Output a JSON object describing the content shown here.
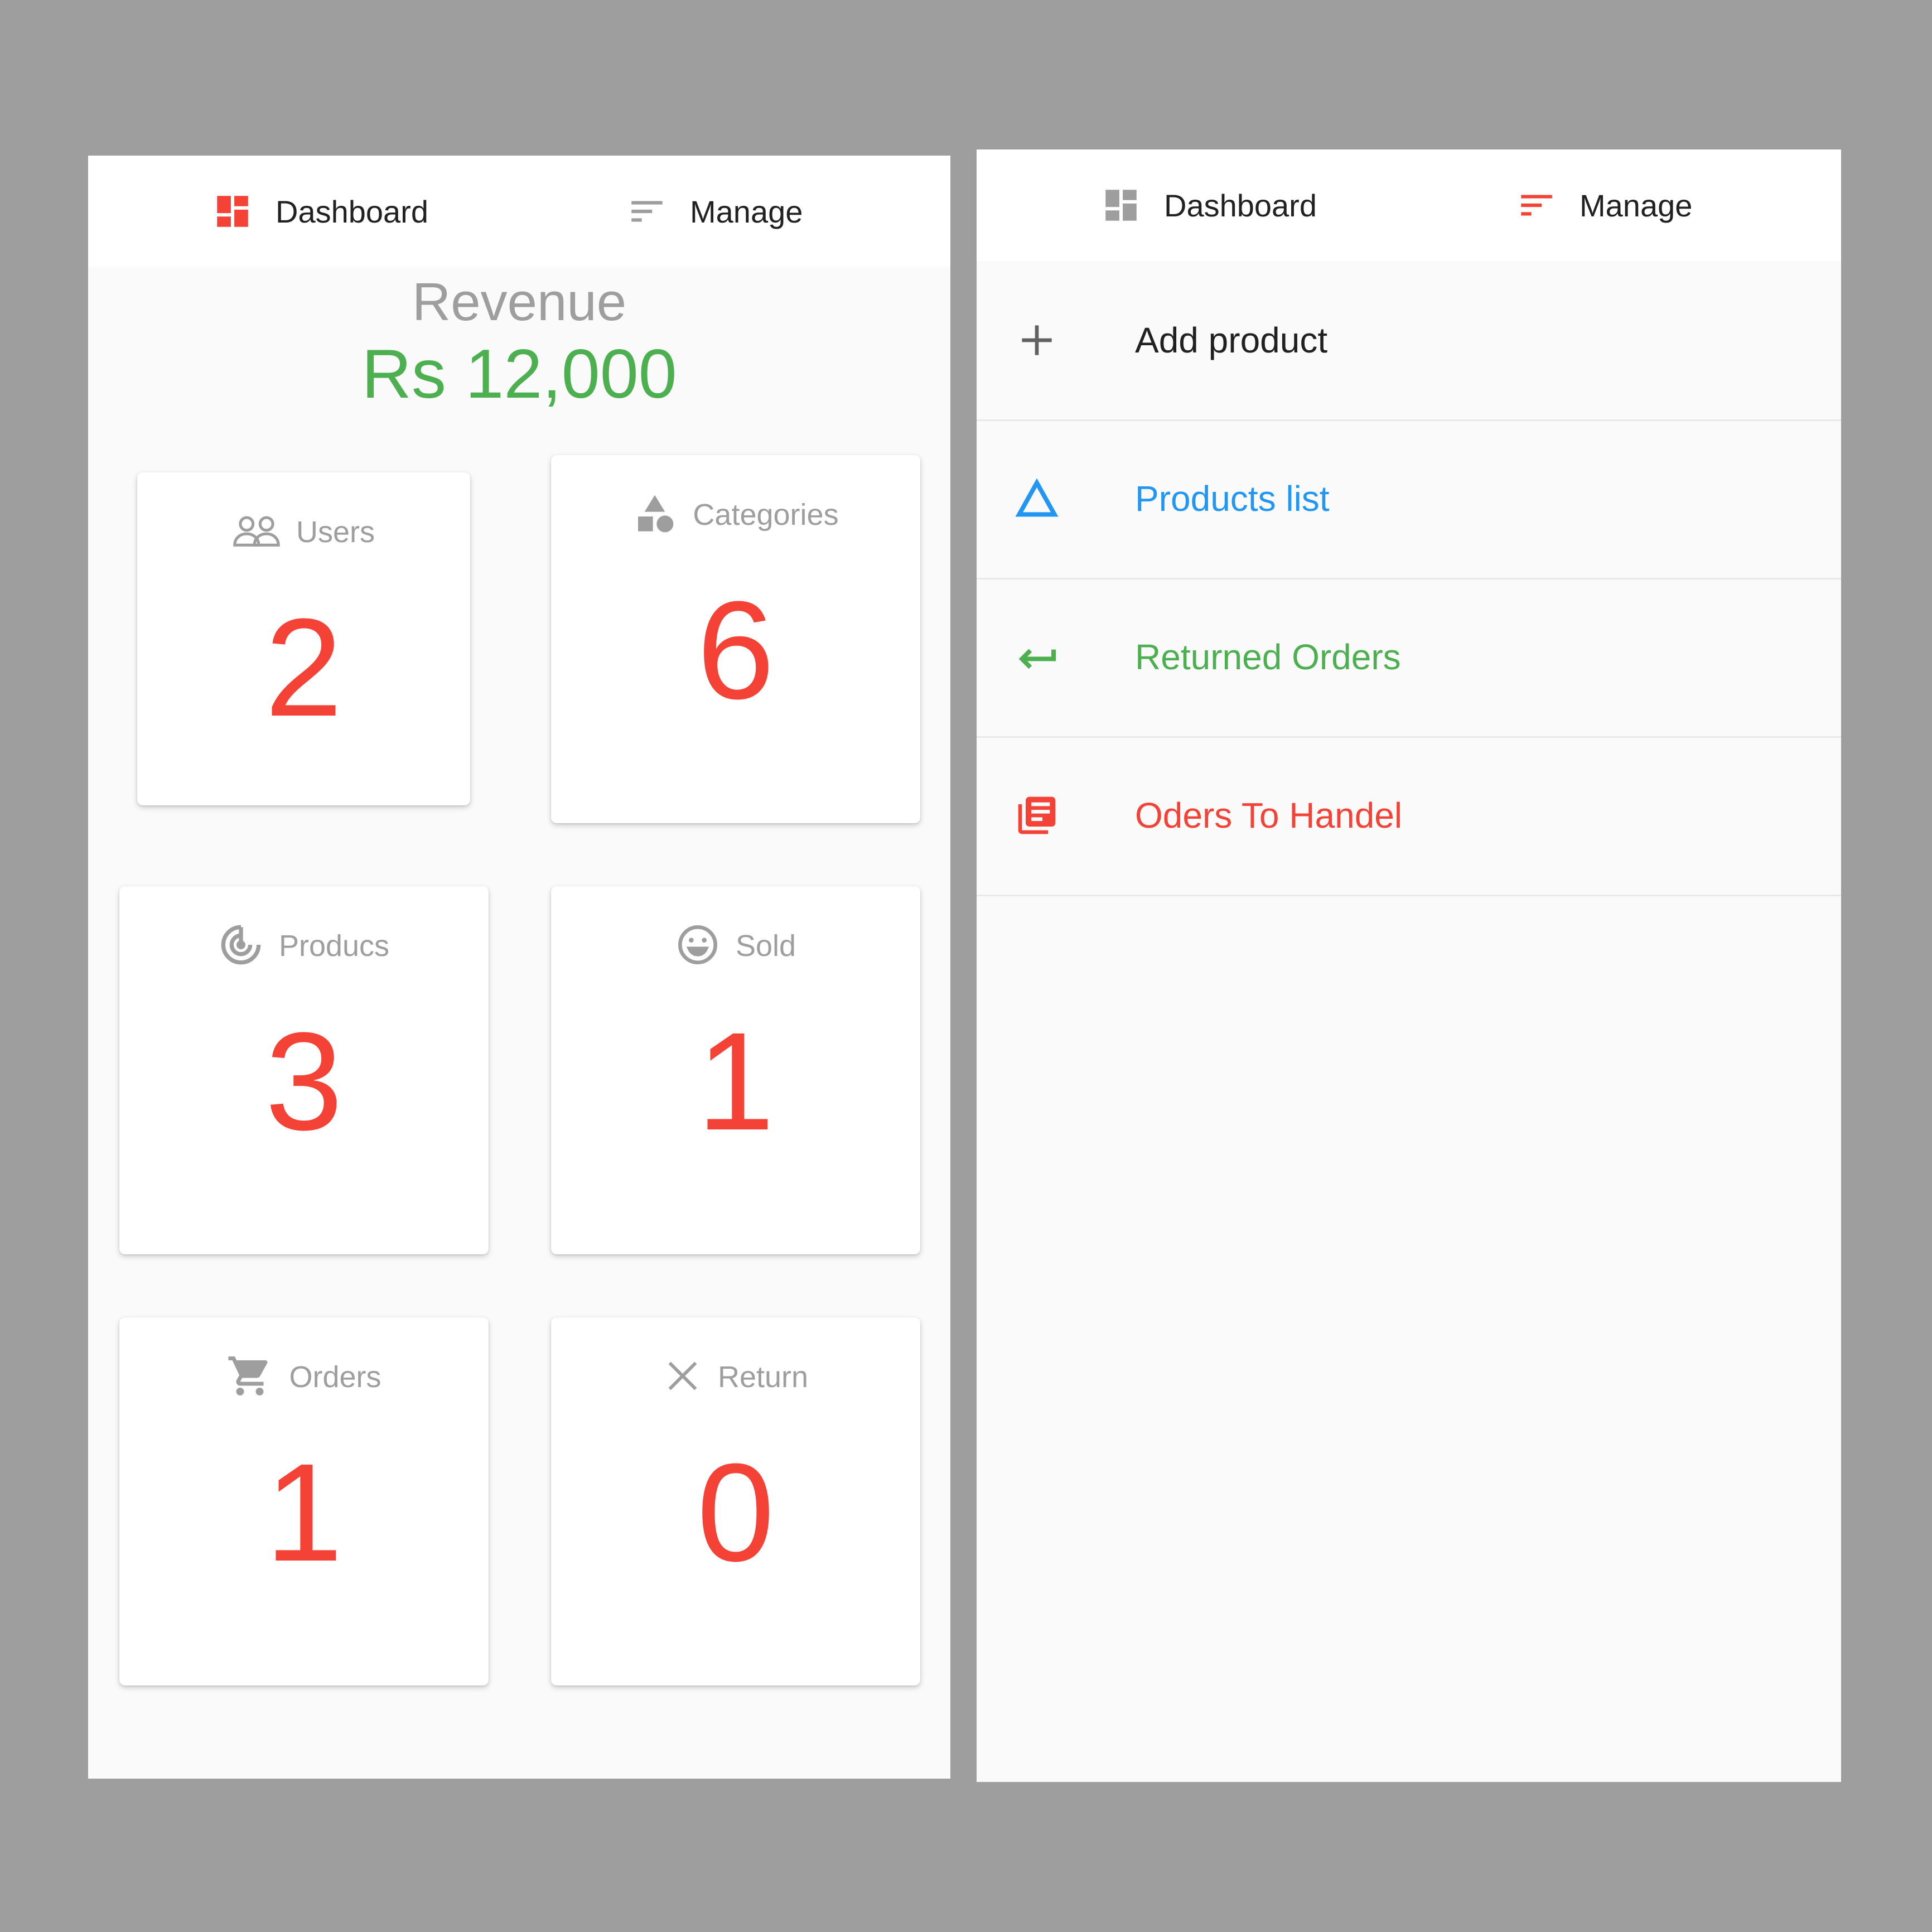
{
  "left_screen": {
    "tabs": [
      {
        "label": "Dashboard",
        "icon": "dashboard-icon",
        "active": true
      },
      {
        "label": "Manage",
        "icon": "sort-lines-icon",
        "active": false
      }
    ],
    "revenue": {
      "label": "Revenue",
      "value": "Rs 12,000"
    },
    "cards": [
      {
        "label": "Users",
        "value": "2",
        "icon": "users-icon"
      },
      {
        "label": "Categories",
        "value": "6",
        "icon": "shapes-icon"
      },
      {
        "label": "Producs",
        "value": "3",
        "icon": "radar-icon"
      },
      {
        "label": "Sold",
        "value": "1",
        "icon": "smiley-icon"
      },
      {
        "label": "Orders",
        "value": "1",
        "icon": "cart-icon"
      },
      {
        "label": "Return",
        "value": "0",
        "icon": "close-icon"
      }
    ]
  },
  "right_screen": {
    "tabs": [
      {
        "label": "Dashboard",
        "icon": "dashboard-icon",
        "active": false
      },
      {
        "label": "Manage",
        "icon": "sort-lines-icon",
        "active": true
      }
    ],
    "menu": [
      {
        "label": "Add product",
        "icon": "plus-icon",
        "color": "#212121"
      },
      {
        "label": "Products list",
        "icon": "triangle-icon",
        "color": "#2196f3"
      },
      {
        "label": "Returned Orders",
        "icon": "return-arrow-icon",
        "color": "#4caf50"
      },
      {
        "label": "Oders To Handel",
        "icon": "library-books-icon",
        "color": "#f44336"
      }
    ]
  },
  "colors": {
    "accent_red": "#f44336",
    "accent_green": "#4caf50",
    "accent_blue": "#2196f3",
    "muted_gray": "#9e9e9e",
    "background": "#9e9e9e"
  }
}
